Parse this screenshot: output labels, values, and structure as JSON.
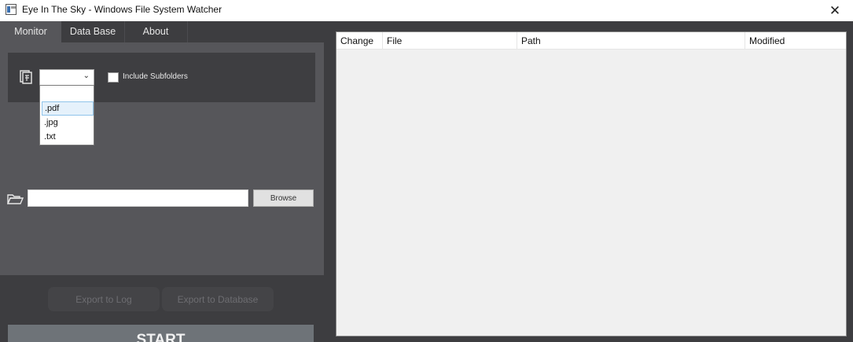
{
  "window": {
    "title": "Eye In The Sky - Windows File System Watcher",
    "close_label": "✕"
  },
  "tabs": [
    {
      "label": "Monitor",
      "active": true
    },
    {
      "label": "Data Base",
      "active": false
    },
    {
      "label": "About",
      "active": false
    }
  ],
  "monitor": {
    "extension_select": {
      "value": ""
    },
    "include_subfolders": {
      "label": "Include Subfolders",
      "checked": false
    },
    "dropdown_options": [
      "",
      ".pdf",
      ".jpg",
      ".txt"
    ],
    "dropdown_highlighted": ".pdf",
    "path_input": {
      "value": ""
    },
    "browse_label": "Browse",
    "export_log_label": "Export to Log",
    "export_db_label": "Export to Database",
    "start_label": "START"
  },
  "list_view": {
    "columns": [
      "Change",
      "File",
      "Path",
      "Modified"
    ],
    "rows": []
  },
  "icons": {
    "app": "app-window-icon",
    "document": "document-filter-icon",
    "folder": "open-folder-icon",
    "chevron": "chevron-down-icon"
  },
  "colors": {
    "panel_dark": "#3d3d40",
    "panel_mid": "#56565a",
    "start_button": "#6e7378",
    "list_background": "#f0f0f0"
  }
}
